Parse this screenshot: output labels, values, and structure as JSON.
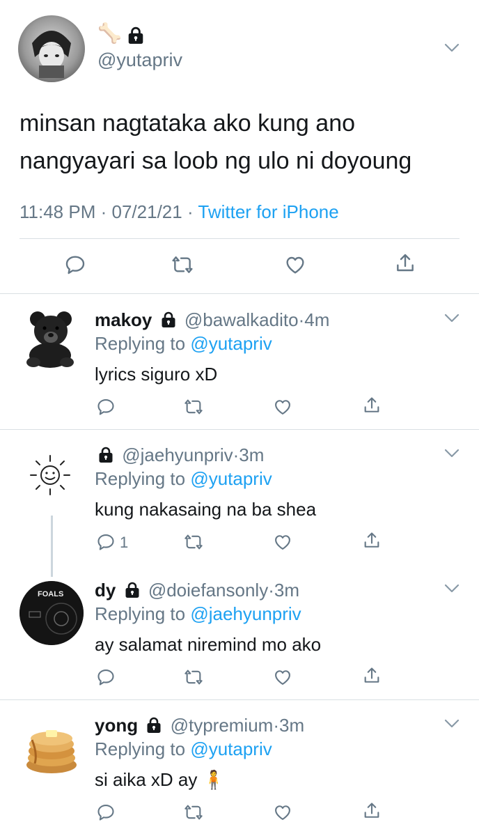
{
  "main_tweet": {
    "display_name_emoji": "🦴",
    "handle": "@yutapriv",
    "text_line1": "minsan nagtataka ako kung ano",
    "text_line2": "nangyayari sa loob ng ulo ni doyoung",
    "time": "11:48 PM",
    "date": "07/21/21",
    "source": "Twitter for iPhone"
  },
  "replies": [
    {
      "name": "makoy",
      "handle": "@bawalkadito",
      "age": "4m",
      "replying_prefix": "Replying to",
      "replying_to": "@yutapriv",
      "text": "lyrics siguro xD",
      "reply_count": ""
    },
    {
      "name": "",
      "handle": "@jaehyunpriv",
      "age": "3m",
      "replying_prefix": "Replying to",
      "replying_to": "@yutapriv",
      "text": "kung nakasaing na ba shea",
      "reply_count": "1"
    },
    {
      "name": "dy",
      "handle": "@doiefansonly",
      "age": "3m",
      "replying_prefix": "Replying to",
      "replying_to": "@jaehyunpriv",
      "text": "ay salamat niremind mo ako",
      "reply_count": "",
      "avatar_label": "FOALS"
    },
    {
      "name": "yong",
      "handle": "@typremium",
      "age": "3m",
      "replying_prefix": "Replying to",
      "replying_to": "@yutapriv",
      "text": "si aika xD ay",
      "text_emoji": "🧍",
      "reply_count": ""
    }
  ],
  "separator": "·",
  "colors": {
    "accent": "#1da1f2",
    "gray": "#657786",
    "divider": "#d9dfe3"
  },
  "icons": [
    "reply-icon",
    "retweet-icon",
    "like-icon",
    "share-icon",
    "lock-icon",
    "chevron-down-icon"
  ]
}
